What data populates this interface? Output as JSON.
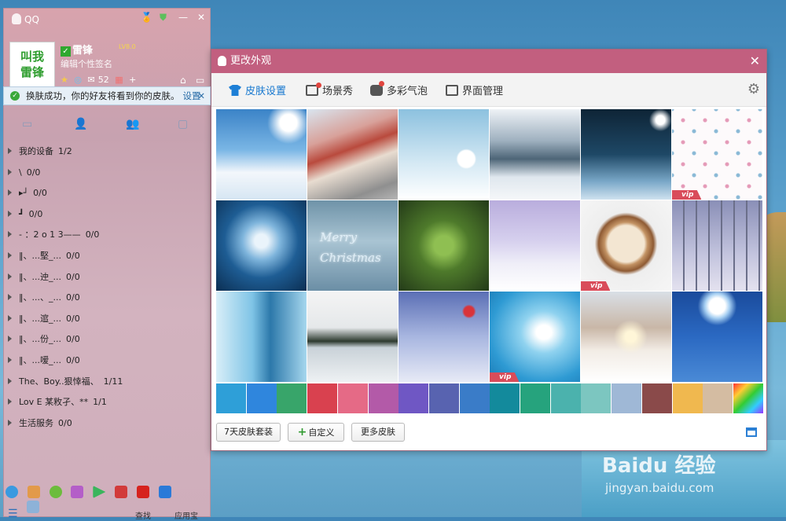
{
  "qq": {
    "title": "QQ",
    "avatar_text": "叫我\n雷锋",
    "nickname": "雷锋",
    "level_badge": "LV8.0",
    "signature": "编辑个性签名",
    "mail_count": "52",
    "notice": {
      "text": "换肤成功，你的好友将看到你的皮肤。",
      "link": "设置"
    },
    "groups": [
      {
        "name": "我的设备",
        "count": "1/2"
      },
      {
        "name": "\\",
        "count": "0/0"
      },
      {
        "name": "▸┘",
        "count": "0/0"
      },
      {
        "name": "┛",
        "count": "0/0"
      },
      {
        "name": "- ：2 o 1 3——",
        "count": "0/0"
      },
      {
        "name": "‖、...堅_...",
        "count": "0/0"
      },
      {
        "name": "‖、...迚_...",
        "count": "0/0"
      },
      {
        "name": "‖、...、_...",
        "count": "0/0"
      },
      {
        "name": "‖、...逭_...",
        "count": "0/0"
      },
      {
        "name": "‖、...份_...",
        "count": "0/0"
      },
      {
        "name": "‖、...嗳_...",
        "count": "0/0"
      },
      {
        "name": "The、Boy..狠悻福、",
        "count": "1/11"
      },
      {
        "name": "Lov E 某敉孑、**",
        "count": "1/1"
      },
      {
        "name": "生活服务",
        "count": "0/0"
      }
    ],
    "bottom_bar": {
      "find": "查找",
      "app_center": "应用宝"
    }
  },
  "skin_window": {
    "title": "更改外观",
    "tabs": [
      {
        "label": "皮肤设置",
        "active": true,
        "icon": "tshirt-icon"
      },
      {
        "label": "场景秀",
        "active": false,
        "icon": "scene-icon",
        "dot": true
      },
      {
        "label": "多彩气泡",
        "active": false,
        "icon": "bubble-icon",
        "dot": true
      },
      {
        "label": "界面管理",
        "active": false,
        "icon": "layout-icon"
      }
    ],
    "thumbnails": [
      {
        "name": "sky-clouds",
        "vip": false
      },
      {
        "name": "town-street",
        "vip": false
      },
      {
        "name": "snowman",
        "vip": false
      },
      {
        "name": "snowy-forest",
        "vip": false
      },
      {
        "name": "night-lamp",
        "vip": false
      },
      {
        "name": "flower-pattern",
        "vip": true
      },
      {
        "name": "snowflake",
        "vip": false
      },
      {
        "name": "merry-christmas",
        "vip": false
      },
      {
        "name": "pine-branch",
        "vip": false
      },
      {
        "name": "couple-walk",
        "vip": false
      },
      {
        "name": "latte-snowflake",
        "vip": true
      },
      {
        "name": "bare-trees",
        "vip": false
      },
      {
        "name": "blue-branches",
        "vip": false
      },
      {
        "name": "winter-lake",
        "vip": false
      },
      {
        "name": "bird-berries",
        "vip": false
      },
      {
        "name": "white-feather",
        "vip": true
      },
      {
        "name": "snow-bridge",
        "vip": false
      },
      {
        "name": "moon-sleigh",
        "vip": false
      }
    ],
    "vip_label": "vip",
    "swatches": [
      "#2e9fd8",
      "#2f86dd",
      "#38a56a",
      "#d9414f",
      "#e56a86",
      "#b35aa8",
      "#6f57c4",
      "#5863b0",
      "#3a7cc8",
      "#138a9c",
      "#26a37d",
      "#4bb2ad",
      "#7cc6c0",
      "#9fb8d6",
      "#8a4a4a",
      "#f0b84f",
      "#d4bca2",
      "rainbow"
    ],
    "buttons": {
      "seven_day": "7天皮肤套装",
      "custom": "自定义",
      "more": "更多皮肤"
    }
  },
  "watermark": {
    "line1": "Baidu 经验",
    "line2": "jingyan.baidu.com"
  }
}
